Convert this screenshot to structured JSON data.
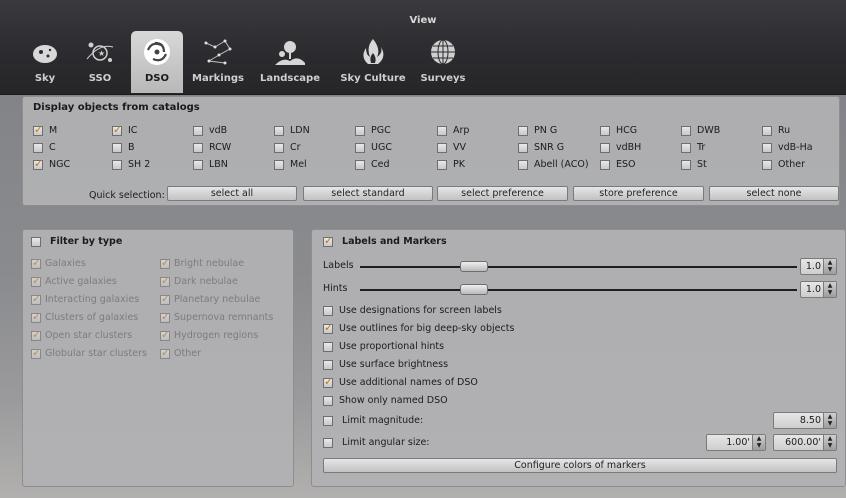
{
  "window": {
    "title": "View"
  },
  "tabs": [
    {
      "label": "Sky",
      "icon": "sky-icon",
      "active": false
    },
    {
      "label": "SSO",
      "icon": "sso-icon",
      "active": false
    },
    {
      "label": "DSO",
      "icon": "galaxy-icon",
      "active": true
    },
    {
      "label": "Markings",
      "icon": "constellation-icon",
      "active": false
    },
    {
      "label": "Landscape",
      "icon": "landscape-icon",
      "active": false
    },
    {
      "label": "Sky Culture",
      "icon": "campfire-icon",
      "active": false
    },
    {
      "label": "Surveys",
      "icon": "globe-icon",
      "active": false
    }
  ],
  "catalogs": {
    "heading": "Display objects from catalogs",
    "items": [
      {
        "label": "M",
        "checked": true
      },
      {
        "label": "IC",
        "checked": true
      },
      {
        "label": "vdB",
        "checked": false
      },
      {
        "label": "LDN",
        "checked": false
      },
      {
        "label": "PGC",
        "checked": false
      },
      {
        "label": "Arp",
        "checked": false
      },
      {
        "label": "PN G",
        "checked": false
      },
      {
        "label": "HCG",
        "checked": false
      },
      {
        "label": "DWB",
        "checked": false
      },
      {
        "label": "Ru",
        "checked": false
      },
      {
        "label": "C",
        "checked": false
      },
      {
        "label": "B",
        "checked": false
      },
      {
        "label": "RCW",
        "checked": false
      },
      {
        "label": "Cr",
        "checked": false
      },
      {
        "label": "UGC",
        "checked": false
      },
      {
        "label": "VV",
        "checked": false
      },
      {
        "label": "SNR G",
        "checked": false
      },
      {
        "label": "vdBH",
        "checked": false
      },
      {
        "label": "Tr",
        "checked": false
      },
      {
        "label": "vdB-Ha",
        "checked": false
      },
      {
        "label": "NGC",
        "checked": true
      },
      {
        "label": "SH 2",
        "checked": false
      },
      {
        "label": "LBN",
        "checked": false
      },
      {
        "label": "Mel",
        "checked": false
      },
      {
        "label": "Ced",
        "checked": false
      },
      {
        "label": "PK",
        "checked": false
      },
      {
        "label": "Abell (ACO)",
        "checked": false
      },
      {
        "label": "ESO",
        "checked": false
      },
      {
        "label": "St",
        "checked": false
      },
      {
        "label": "Other",
        "checked": false
      }
    ],
    "quick_selection_label": "Quick selection:",
    "buttons": {
      "select_all": "select all",
      "select_standard": "select standard",
      "select_preference": "select preference",
      "store_preference": "store preference",
      "select_none": "select none"
    }
  },
  "filter": {
    "heading": "Filter by type",
    "checked": false,
    "items": [
      {
        "label": "Galaxies",
        "checked": true
      },
      {
        "label": "Bright nebulae",
        "checked": true
      },
      {
        "label": "Active galaxies",
        "checked": true
      },
      {
        "label": "Dark nebulae",
        "checked": true
      },
      {
        "label": "Interacting galaxies",
        "checked": true
      },
      {
        "label": "Planetary nebulae",
        "checked": true
      },
      {
        "label": "Clusters of galaxies",
        "checked": true
      },
      {
        "label": "Supernova remnants",
        "checked": true
      },
      {
        "label": "Open star clusters",
        "checked": true
      },
      {
        "label": "Hydrogen regions",
        "checked": true
      },
      {
        "label": "Globular star clusters",
        "checked": true
      },
      {
        "label": "Other",
        "checked": true
      }
    ]
  },
  "labels_markers": {
    "heading": "Labels and Markers",
    "checked": true,
    "labels_slider": {
      "label": "Labels",
      "value": "1.0",
      "fraction": 0.26
    },
    "hints_slider": {
      "label": "Hints",
      "value": "1.0",
      "fraction": 0.26
    },
    "options": [
      {
        "label": "Use designations for screen labels",
        "checked": false
      },
      {
        "label": "Use outlines for big deep-sky objects",
        "checked": true
      },
      {
        "label": "Use proportional hints",
        "checked": false
      },
      {
        "label": "Use surface brightness",
        "checked": false
      },
      {
        "label": "Use additional names of DSO",
        "checked": true
      },
      {
        "label": "Show only named DSO",
        "checked": false
      }
    ],
    "limit_magnitude": {
      "label": "Limit magnitude:",
      "checked": false,
      "value": "8.50"
    },
    "limit_angular_size": {
      "label": "Limit angular size:",
      "checked": false,
      "min": "1.00'",
      "max": "600.00'"
    },
    "configure_button": "Configure colors of markers"
  }
}
